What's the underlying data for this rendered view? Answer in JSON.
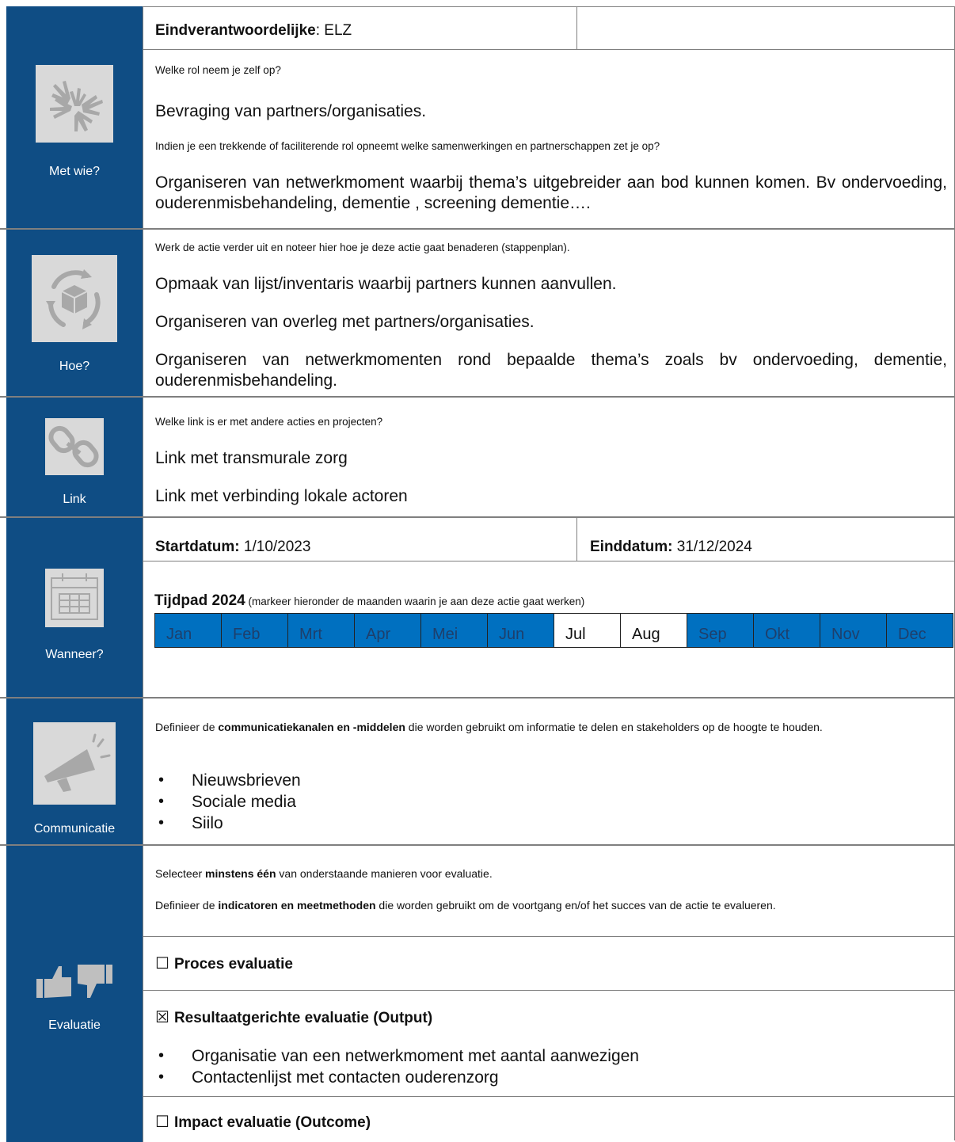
{
  "met_wie": {
    "side_label": "Met wie?",
    "icon": "hands-circle-icon",
    "owner_label": "Eindverantwoordelijke",
    "owner_value": ": ELZ",
    "q1": "Welke rol neem je zelf op?",
    "a1": "Bevraging van partners/organisaties.",
    "q2": "Indien je een trekkende of faciliterende rol opneemt welke samenwerkingen en partnerschappen zet je op?",
    "a2": "Organiseren van netwerkmoment waarbij thema’s uitgebreider aan bod kunnen komen. Bv ondervoeding, ouderenmisbehandeling, dementie , screening dementie…."
  },
  "hoe": {
    "side_label": "Hoe?",
    "icon": "box-cycle-icon",
    "q": "Werk de actie verder uit en noteer hier hoe je deze actie gaat benaderen (stappenplan).",
    "steps": [
      "Opmaak van lijst/inventaris waarbij partners kunnen aanvullen.",
      "Organiseren van overleg met partners/organisaties.",
      "Organiseren van netwerkmomenten rond bepaalde thema’s zoals bv ondervoeding, dementie, ouderenmisbehandeling."
    ]
  },
  "link": {
    "side_label": "Link",
    "icon": "chain-link-icon",
    "q": "Welke link is er met andere acties en projecten?",
    "items": [
      "Link met transmurale zorg",
      "Link met verbinding lokale actoren"
    ]
  },
  "wanneer": {
    "side_label": "Wanneer?",
    "icon": "calendar-icon",
    "start_label": "Startdatum:",
    "start_value": " 1/10/2023",
    "end_label": "Einddatum:",
    "end_value": " 31/12/2024",
    "timeline_title": "Tijdpad 2024",
    "timeline_note": " (markeer hieronder de maanden waarin je aan deze actie gaat werken)",
    "months": [
      {
        "name": "Jan",
        "active": true
      },
      {
        "name": "Feb",
        "active": true
      },
      {
        "name": "Mrt",
        "active": true
      },
      {
        "name": "Apr",
        "active": true
      },
      {
        "name": "Mei",
        "active": true
      },
      {
        "name": "Jun",
        "active": true
      },
      {
        "name": "Jul",
        "active": false
      },
      {
        "name": "Aug",
        "active": false
      },
      {
        "name": "Sep",
        "active": true
      },
      {
        "name": "Okt",
        "active": true
      },
      {
        "name": "Nov",
        "active": true
      },
      {
        "name": "Dec",
        "active": true
      }
    ]
  },
  "communicatie": {
    "side_label": "Communicatie",
    "icon": "megaphone-icon",
    "intro_pre": "Definieer de ",
    "intro_bold": "communicatiekanalen en -middelen",
    "intro_post": " die worden gebruikt om informatie te delen en stakeholders op de hoogte te houden.",
    "items": [
      "Nieuwsbrieven",
      "Sociale media",
      "Siilo"
    ]
  },
  "evaluatie": {
    "side_label": "Evaluatie",
    "icon": "thumbs-up-down-icon",
    "sel_pre": "Selecteer ",
    "sel_bold": "minstens één",
    "sel_post": " van onderstaande manieren voor evaluatie.",
    "def_pre": "Definieer de ",
    "def_bold": "indicatoren en meetmethoden",
    "def_post": " die worden gebruikt om de voortgang en/of het succes van de actie te evalueren.",
    "options": [
      {
        "box": "☐",
        "label": "Proces evaluatie"
      },
      {
        "box": "☒",
        "label": "Resultaatgerichte evaluatie (Output)"
      },
      {
        "box": "☐",
        "label": "Impact evaluatie (Outcome)"
      }
    ],
    "output_items": [
      "Organisatie van een netwerkmoment met aantal aanwezigen",
      "Contactenlijst met contacten ouderenzorg"
    ]
  },
  "colors": {
    "sidebar": "#0f4d84",
    "month_active": "#0070c0",
    "icon_bg": "#d9d9d9"
  }
}
